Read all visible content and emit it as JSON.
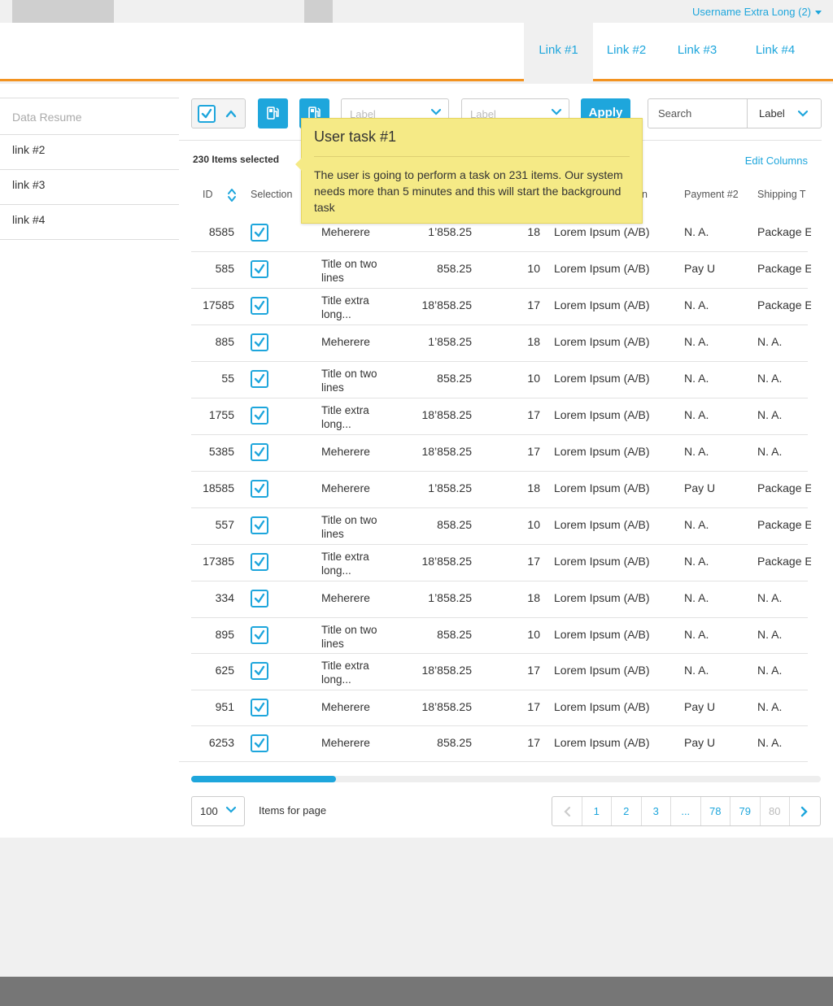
{
  "topbar": {
    "username": "Username Extra Long (2)"
  },
  "nav": {
    "links": [
      "Link #1",
      "Link #2",
      "Link #3",
      "Link #4"
    ]
  },
  "sidebar": {
    "title": "Data Resume",
    "items": [
      "link #2",
      "link #3",
      "link #4"
    ]
  },
  "toolbar": {
    "select1_placeholder": "Label",
    "select2_placeholder": "Label",
    "apply_label": "Apply",
    "search_placeholder": "Search",
    "search_filter_label": "Label"
  },
  "tooltip": {
    "title": "User task #1",
    "body": "The user is going to perform a task on 231 items. Our system needs more than 5 minutes and this will start the background task"
  },
  "table": {
    "selected_count": "230 Items selected",
    "edit_columns": "Edit Columns",
    "headers": {
      "id": "ID",
      "selection": "Selection",
      "col_n": "n",
      "payment2": "Payment #2",
      "shipping": "Shipping T"
    },
    "rows": [
      {
        "id": "8585",
        "title": "Meherere",
        "amount": "1’858.25",
        "qty": "18",
        "lorem": "Lorem Ipsum (A/B)",
        "payment": "N. A.",
        "shipping": "Package E"
      },
      {
        "id": "585",
        "title": "Title on two lines",
        "amount": "858.25",
        "qty": "10",
        "lorem": "Lorem Ipsum (A/B)",
        "payment": "Pay U",
        "shipping": "Package E"
      },
      {
        "id": "17585",
        "title": "Title extra long...",
        "amount": "18’858.25",
        "qty": "17",
        "lorem": "Lorem Ipsum (A/B)",
        "payment": "N. A.",
        "shipping": "Package E"
      },
      {
        "id": "885",
        "title": "Meherere",
        "amount": "1’858.25",
        "qty": "18",
        "lorem": "Lorem Ipsum (A/B)",
        "payment": "N. A.",
        "shipping": "N. A."
      },
      {
        "id": "55",
        "title": "Title on two lines",
        "amount": "858.25",
        "qty": "10",
        "lorem": "Lorem Ipsum (A/B)",
        "payment": "N. A.",
        "shipping": "N. A."
      },
      {
        "id": "1755",
        "title": "Title extra long...",
        "amount": "18’858.25",
        "qty": "17",
        "lorem": "Lorem Ipsum (A/B)",
        "payment": "N. A.",
        "shipping": "N. A."
      },
      {
        "id": "5385",
        "title": "Meherere",
        "amount": "18’858.25",
        "qty": "17",
        "lorem": "Lorem Ipsum (A/B)",
        "payment": "N. A.",
        "shipping": "N. A."
      },
      {
        "id": "18585",
        "title": "Meherere",
        "amount": "1’858.25",
        "qty": "18",
        "lorem": "Lorem Ipsum (A/B)",
        "payment": "Pay U",
        "shipping": "Package E"
      },
      {
        "id": "557",
        "title": "Title on two lines",
        "amount": "858.25",
        "qty": "10",
        "lorem": "Lorem Ipsum (A/B)",
        "payment": "N. A.",
        "shipping": "Package E"
      },
      {
        "id": "17385",
        "title": "Title extra long...",
        "amount": "18’858.25",
        "qty": "17",
        "lorem": "Lorem Ipsum (A/B)",
        "payment": "N. A.",
        "shipping": "Package E"
      },
      {
        "id": "334",
        "title": "Meherere",
        "amount": "1’858.25",
        "qty": "18",
        "lorem": "Lorem Ipsum (A/B)",
        "payment": "N. A.",
        "shipping": "N. A."
      },
      {
        "id": "895",
        "title": "Title on two lines",
        "amount": "858.25",
        "qty": "10",
        "lorem": "Lorem Ipsum (A/B)",
        "payment": "N. A.",
        "shipping": "N. A."
      },
      {
        "id": "625",
        "title": "Title extra long...",
        "amount": "18’858.25",
        "qty": "17",
        "lorem": "Lorem Ipsum (A/B)",
        "payment": "N. A.",
        "shipping": "N. A."
      },
      {
        "id": "951",
        "title": "Meherere",
        "amount": "18’858.25",
        "qty": "17",
        "lorem": "Lorem Ipsum (A/B)",
        "payment": "Pay U",
        "shipping": "N. A."
      },
      {
        "id": "6253",
        "title": "Meherere",
        "amount": "858.25",
        "qty": "17",
        "lorem": "Lorem Ipsum (A/B)",
        "payment": "Pay U",
        "shipping": "N. A."
      }
    ]
  },
  "pagination": {
    "per_page": "100",
    "per_page_label": "Items for page",
    "pages": [
      "1",
      "2",
      "3",
      "...",
      "78",
      "79",
      "80"
    ],
    "scroll_fraction": 0.23
  },
  "colors": {
    "accent": "#1ea6dc",
    "header_border": "#f39320",
    "tooltip": "#f5ea86"
  },
  "icons": [
    "caret-down-icon",
    "check-icon",
    "chevron-up-icon",
    "chevron-down-icon",
    "fuel-icon",
    "sort-icon",
    "chevron-left-icon",
    "chevron-right-icon"
  ]
}
